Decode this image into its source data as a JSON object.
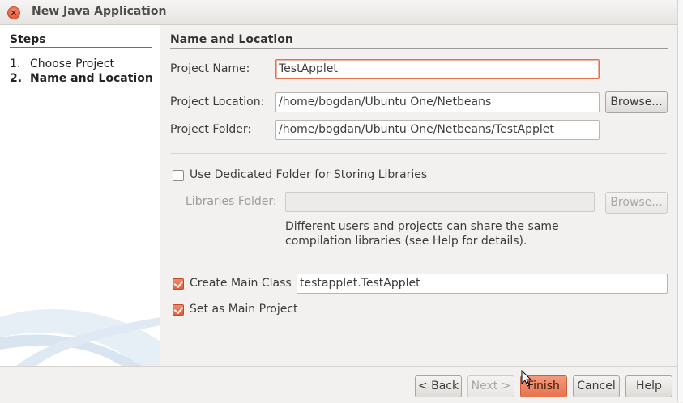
{
  "window": {
    "title": "New Java Application"
  },
  "steps": {
    "title": "Steps",
    "items": [
      {
        "num": "1.",
        "label": "Choose Project"
      },
      {
        "num": "2.",
        "label": "Name and Location"
      }
    ]
  },
  "form": {
    "section_title": "Name and Location",
    "project_name": {
      "label": "Project Name:",
      "value": "TestApplet"
    },
    "project_location": {
      "label": "Project Location:",
      "value": "/home/bogdan/Ubuntu One/Netbeans",
      "browse": "Browse..."
    },
    "project_folder": {
      "label": "Project Folder:",
      "value": "/home/bogdan/Ubuntu One/Netbeans/TestApplet"
    },
    "dedicated_folder": {
      "label": "Use Dedicated Folder for Storing Libraries",
      "checked": false
    },
    "libraries_folder": {
      "label": "Libraries Folder:",
      "value": "",
      "browse": "Browse..."
    },
    "hint": "Different users and projects can share the same compilation libraries (see Help for details).",
    "create_main_class": {
      "label": "Create Main Class",
      "checked": true,
      "value": "testapplet.TestApplet"
    },
    "set_main_project": {
      "label": "Set as Main Project",
      "checked": true
    }
  },
  "buttons": {
    "back": "< Back",
    "next": "Next >",
    "finish": "Finish",
    "cancel": "Cancel",
    "help": "Help"
  },
  "colors": {
    "accent": "#e8734f",
    "focus_border": "#e2704a"
  }
}
